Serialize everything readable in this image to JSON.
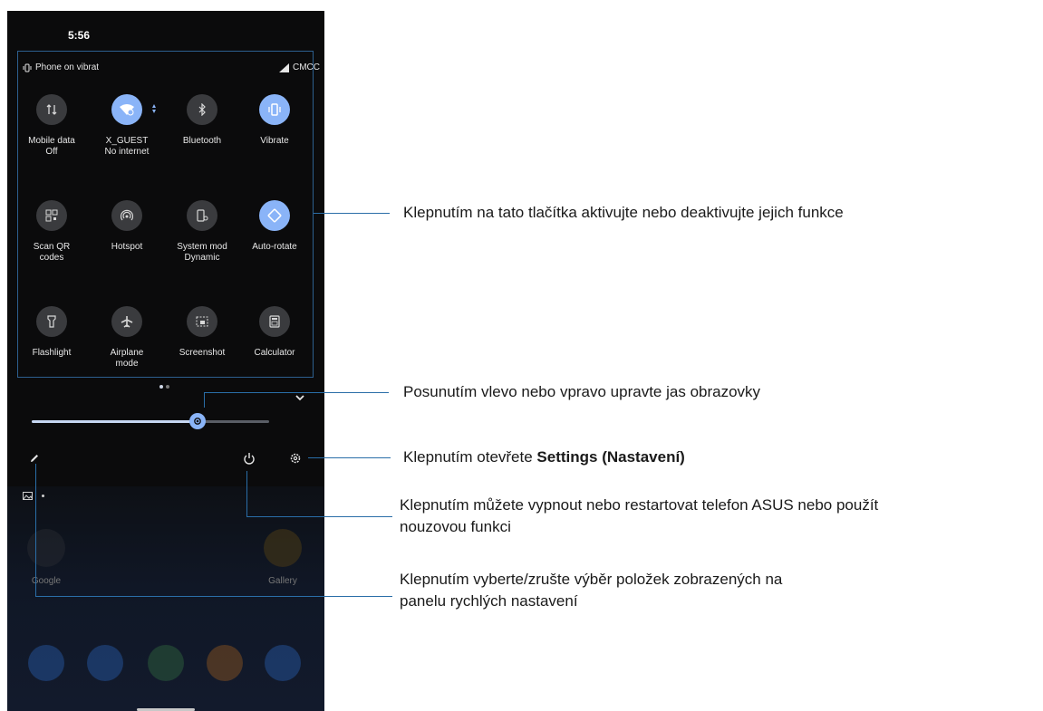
{
  "status": {
    "time": "5:56",
    "ringer_text": "Phone on vibrat",
    "carrier": "CMCC"
  },
  "tiles": [
    {
      "label": "Mobile data\nOff",
      "icon": "mobile-data-icon",
      "active": false
    },
    {
      "label": "X_GUEST\nNo internet",
      "icon": "wifi-icon",
      "active": true
    },
    {
      "label": "Bluetooth",
      "icon": "bluetooth-icon",
      "active": false
    },
    {
      "label": "Vibrate",
      "icon": "vibrate-icon",
      "active": true
    },
    {
      "label": "Scan QR\ncodes",
      "icon": "qr-code-icon",
      "active": false
    },
    {
      "label": "Hotspot",
      "icon": "hotspot-icon",
      "active": false
    },
    {
      "label": "System mod\nDynamic",
      "icon": "system-mode-icon",
      "active": false
    },
    {
      "label": "Auto-rotate",
      "icon": "auto-rotate-icon",
      "active": true
    },
    {
      "label": "Flashlight",
      "icon": "flashlight-icon",
      "active": false
    },
    {
      "label": "Airplane\nmode",
      "icon": "airplane-icon",
      "active": false
    },
    {
      "label": "Screenshot",
      "icon": "screenshot-icon",
      "active": false
    },
    {
      "label": "Calculator",
      "icon": "calculator-icon",
      "active": false
    }
  ],
  "brightness": {
    "level": 0.7
  },
  "home": {
    "left_app": "Google",
    "right_app": "Gallery"
  },
  "annotations": {
    "tiles": "Klepnutím na tato tlačítka aktivujte nebo deaktivujte jejich funkce",
    "brightness": "Posunutím vlevo nebo vpravo upravte jas obrazovky",
    "settings_prefix": "Klepnutím otevřete ",
    "settings_bold": "Settings (Nastavení)",
    "power_line1": "Klepnutím můžete vypnout nebo restartovat telefon ASUS nebo použít",
    "power_line2": "nouzovou funkci",
    "edit_line1": "Klepnutím vyberte/zrušte výběr položek zobrazených na",
    "edit_line2": "panelu rychlých nastavení"
  },
  "colors": {
    "accent": "#8ab4f8",
    "tile_off": "#3a3b3e",
    "annotation_line": "#2a6ea8"
  }
}
